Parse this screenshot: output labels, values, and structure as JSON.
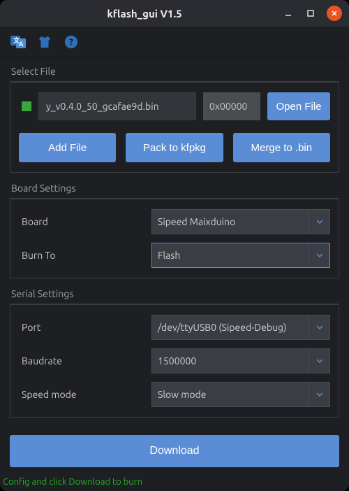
{
  "window": {
    "title": "kflash_gui V1.5"
  },
  "selectFile": {
    "label": "Select File",
    "filename": "y_v0.4.0_50_gcafae9d.bin",
    "address": "0x00000",
    "openLabel": "Open File",
    "addFileLabel": "Add File",
    "packLabel": "Pack to kfpkg",
    "mergeLabel": "Merge to .bin"
  },
  "boardSettings": {
    "label": "Board Settings",
    "boardLabel": "Board",
    "boardValue": "Sipeed Maixduino",
    "burnToLabel": "Burn To",
    "burnToValue": "Flash"
  },
  "serialSettings": {
    "label": "Serial Settings",
    "portLabel": "Port",
    "portValue": "/dev/ttyUSB0 (Sipeed-Debug)",
    "baudLabel": "Baudrate",
    "baudValue": "1500000",
    "speedLabel": "Speed mode",
    "speedValue": "Slow mode"
  },
  "downloadLabel": "Download",
  "status": "Config and click Download to burn"
}
